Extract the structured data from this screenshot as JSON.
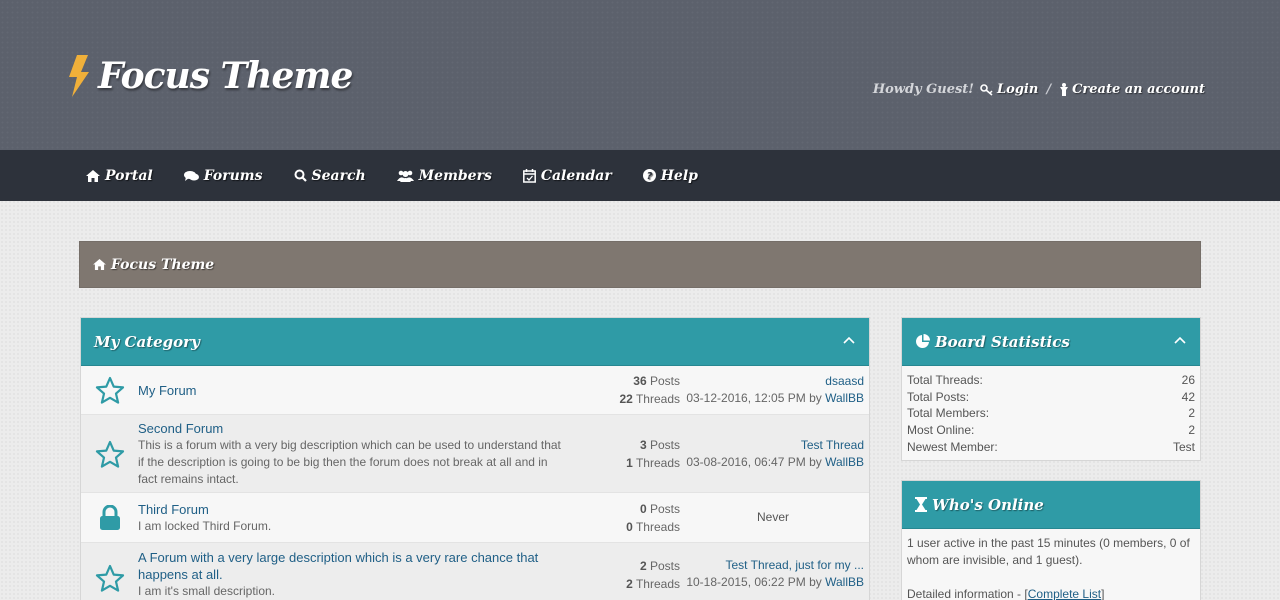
{
  "header": {
    "logo": "Focus Theme",
    "greeting": "Howdy Guest!",
    "login": "Login",
    "separator": "/",
    "create_account": "Create an account"
  },
  "nav": [
    {
      "label": "Portal",
      "icon": "home-icon"
    },
    {
      "label": "Forums",
      "icon": "comments-icon"
    },
    {
      "label": "Search",
      "icon": "search-icon"
    },
    {
      "label": "Members",
      "icon": "users-icon"
    },
    {
      "label": "Calendar",
      "icon": "calendar-icon"
    },
    {
      "label": "Help",
      "icon": "help-icon"
    }
  ],
  "breadcrumb": {
    "label": "Focus Theme"
  },
  "category": {
    "title": "My Category",
    "forums": [
      {
        "name": "My Forum",
        "description": "",
        "posts": "36",
        "posts_label": "Posts",
        "threads": "22",
        "threads_label": "Threads",
        "last_title": "dsaasd",
        "last_date": "03-12-2016, 12:05 PM by",
        "last_user": "WallBB",
        "icon": "star-icon"
      },
      {
        "name": "Second Forum",
        "description": "This is a forum with a very big description which can be used to understand that if the description is going to be big then the forum does not break at all and in fact remains intact.",
        "posts": "3",
        "posts_label": "Posts",
        "threads": "1",
        "threads_label": "Threads",
        "last_title": "Test Thread",
        "last_date": "03-08-2016, 06:47 PM by",
        "last_user": "WallBB",
        "icon": "star-icon"
      },
      {
        "name": "Third Forum",
        "description": "I am locked Third Forum.",
        "posts": "0",
        "posts_label": "Posts",
        "threads": "0",
        "threads_label": "Threads",
        "last_never": "Never",
        "icon": "lock-icon"
      },
      {
        "name": "A Forum with a very large description which is a very rare chance that happens at all.",
        "description": "I am it's small description.",
        "posts": "2",
        "posts_label": "Posts",
        "threads": "2",
        "threads_label": "Threads",
        "last_title": "Test Thread, just for my ...",
        "last_date": "10-18-2015, 06:22 PM by",
        "last_user": "WallBB",
        "icon": "star-icon"
      }
    ]
  },
  "board_stats": {
    "title": "Board Statistics",
    "rows": [
      {
        "label": "Total Threads:",
        "value": "26"
      },
      {
        "label": "Total Posts:",
        "value": "42"
      },
      {
        "label": "Total Members:",
        "value": "2"
      },
      {
        "label": "Most Online:",
        "value": "2"
      },
      {
        "label": "Newest Member:",
        "value": "Test"
      }
    ]
  },
  "whos_online": {
    "title": "Who's Online",
    "summary": "1 user active in the past 15 minutes (0 members, 0 of whom are invisible, and 1 guest).",
    "detail_prefix": "Detailed information - [",
    "detail_link": "Complete List",
    "detail_suffix": "]"
  },
  "colors": {
    "accent": "#2f9ba6",
    "header": "#5c616c",
    "nav": "#2d323b",
    "breadcrumb": "#7f7770",
    "link": "#1f5f86"
  }
}
